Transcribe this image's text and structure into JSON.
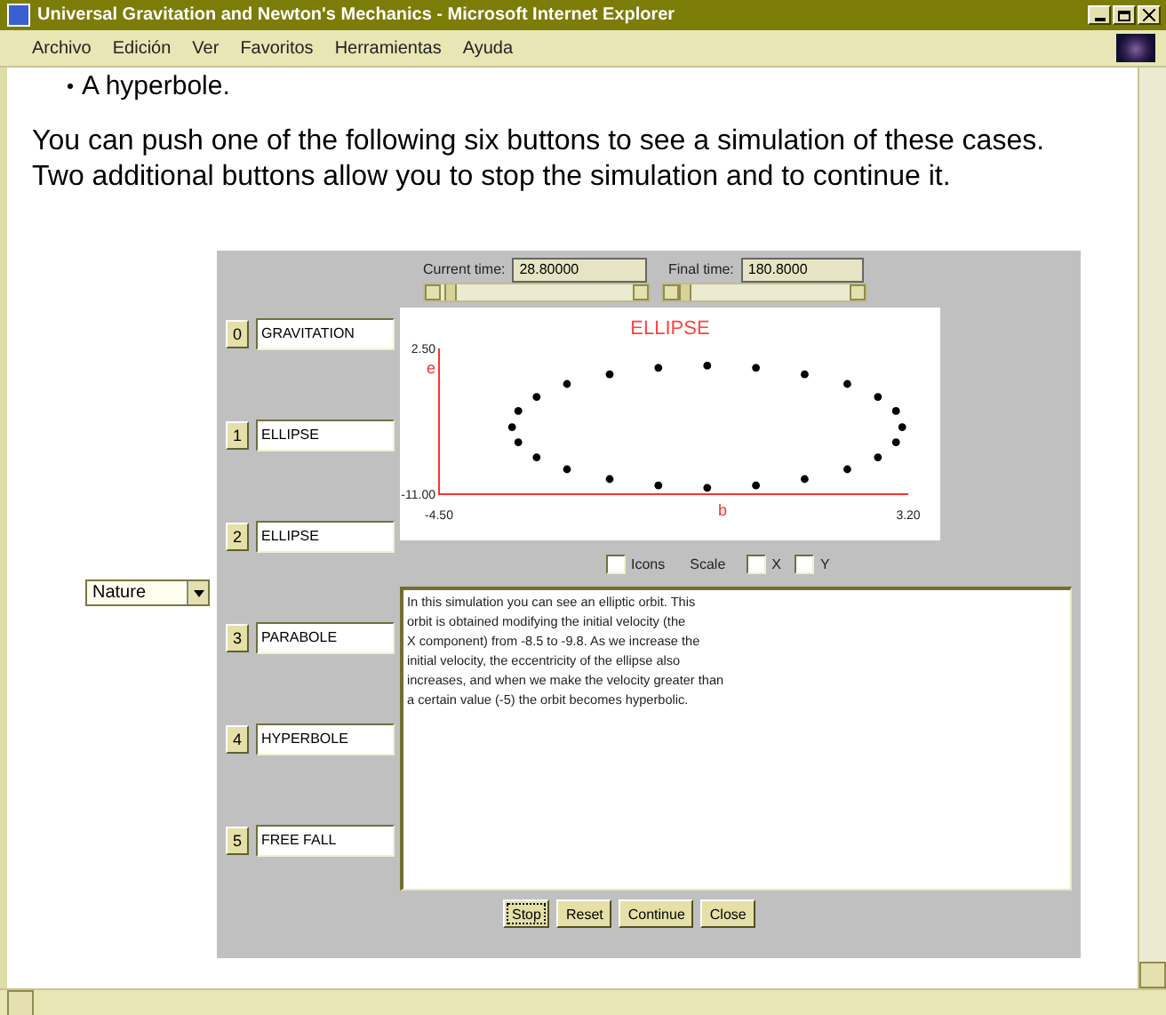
{
  "window": {
    "title": "Universal Gravitation and Newton's Mechanics - Microsoft Internet Explorer"
  },
  "menu": [
    "Archivo",
    "Edición",
    "Ver",
    "Favoritos",
    "Herramientas",
    "Ayuda"
  ],
  "content": {
    "bullet_item": "A hyperbole.",
    "paragraph": [
      "You can push one of the following six buttons to see a simulation of these cases.",
      "Two additional buttons allow you to stop the simulation and to continue it."
    ]
  },
  "mode_select": {
    "value": "Nature"
  },
  "applet": {
    "current_time": {
      "label": "Current time:",
      "value": "28.80000",
      "level": 0.02
    },
    "final_time": {
      "label": "Final time:",
      "value": "180.8000",
      "level": 0.0
    },
    "cases": [
      {
        "number": "0",
        "name": "GRAVITATION"
      },
      {
        "number": "1",
        "name": "ELLIPSE"
      },
      {
        "number": "2",
        "name": "ELLIPSE"
      },
      {
        "number": "3",
        "name": "PARABOLE"
      },
      {
        "number": "4",
        "name": "HYPERBOLE"
      },
      {
        "number": "5",
        "name": "FREE FALL"
      }
    ],
    "plot": {
      "chart_data": {
        "type": "scatter",
        "title": "ELLIPSE",
        "xlabel": "b",
        "ylabel": "e",
        "xlim": [
          -4.5,
          3.2
        ],
        "ylim": [
          -11,
          2.5
        ],
        "xticks": [
          {
            "value": -4.5,
            "label": "-4.50"
          },
          {
            "value": 3.2,
            "label": "3.20"
          }
        ],
        "yticks": [
          {
            "value": 2.5,
            "label": "2.50"
          },
          {
            "value": -11,
            "label": "-11.00"
          }
        ],
        "x": [
          3.1,
          3.0,
          2.7,
          2.2,
          1.5,
          0.7,
          -0.1,
          -0.9,
          -1.7,
          -2.4,
          -2.9,
          -3.2,
          -3.3,
          -3.2,
          -2.9,
          -2.4,
          -1.7,
          -0.9,
          -0.1,
          0.7,
          1.5,
          2.2,
          2.7,
          3.0
        ],
        "series": [
          {
            "color": "#000000",
            "values": [
              -4.8,
              -3.3,
              -2.0,
              -0.8,
              0.1,
              0.7,
              0.9,
              0.7,
              0.1,
              -0.8,
              -2.0,
              -3.3,
              -4.8,
              -6.2,
              -7.6,
              -8.7,
              -9.6,
              -10.2,
              -10.4,
              -10.2,
              -9.6,
              -8.7,
              -7.6,
              -6.2
            ]
          }
        ]
      }
    },
    "options": [
      {
        "kind": "checkbox",
        "label": "Icons",
        "checked": false
      },
      {
        "kind": "label",
        "label": "Scale"
      },
      {
        "kind": "checkbox",
        "label": "X",
        "checked": false
      },
      {
        "kind": "checkbox",
        "label": "Y",
        "checked": false
      }
    ],
    "description": [
      "In this simulation you can see an elliptic orbit. This",
      "orbit is obtained modifying the initial velocity (the",
      "X component) from -8.5 to -9.8. As we increase the",
      "initial velocity, the eccentricity of the ellipse also",
      "increases, and when we make the velocity greater than",
      "a certain value (-5) the orbit becomes hyperbolic."
    ],
    "buttons": [
      "Stop",
      "Reset",
      "Continue",
      "Close"
    ]
  }
}
